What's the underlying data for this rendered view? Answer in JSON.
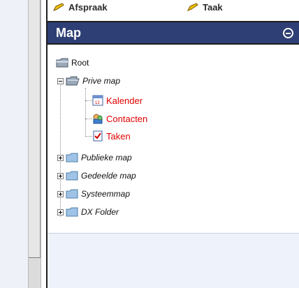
{
  "toolbar": {
    "item1": "Afspraak",
    "item2": "Taak"
  },
  "panel": {
    "title": "Map"
  },
  "tree": {
    "root": "Root",
    "private": "Prive map",
    "calendar": "Kalender",
    "contacts": "Contacten",
    "tasks": "Taken",
    "public": "Publieke map",
    "shared": "Gedeelde map",
    "system": "Systeemmap",
    "dx": "DX Folder"
  },
  "colors": {
    "header": "#2e3f75",
    "red_text": "#e00000"
  }
}
